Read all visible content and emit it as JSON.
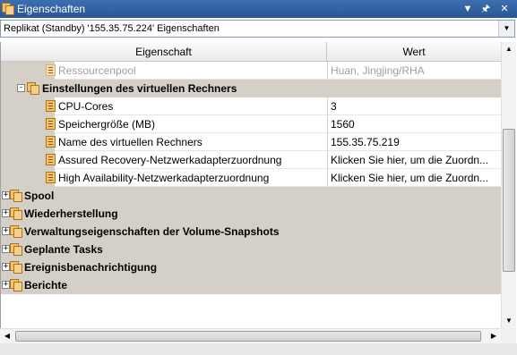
{
  "window": {
    "title": "Eigenschaften",
    "btn_dropdown": "▼",
    "btn_pin": "🖈",
    "btn_close": "✕"
  },
  "selector": {
    "value": "Replikat (Standby) '155.35.75.224' Eigenschaften"
  },
  "grid": {
    "headers": {
      "property": "Eigenschaft",
      "value": "Wert"
    },
    "rows": [
      {
        "name": "Ressourcenpool",
        "value": "Huan, Jingjing/RHA"
      },
      {
        "name": "Einstellungen des virtuellen Rechners"
      },
      {
        "name": "CPU-Cores",
        "value": "3"
      },
      {
        "name": "Speichergröße (MB)",
        "value": "1560"
      },
      {
        "name": "Name des virtuellen Rechners",
        "value": "155.35.75.219"
      },
      {
        "name": "Assured Recovery-Netzwerkadapterzuordnung",
        "value": "Klicken Sie hier, um die Zuordn..."
      },
      {
        "name": "High Availability-Netzwerkadapterzuordnung",
        "value": "Klicken Sie hier, um die Zuordn..."
      }
    ],
    "groups": [
      "Spool",
      "Wiederherstellung",
      "Verwaltungseigenschaften der Volume-Snapshots",
      "Geplante Tasks",
      "Ereignisbenachrichtigung",
      "Berichte"
    ]
  },
  "colors": {
    "titlebar": "#2a5592",
    "category_bg": "#d4d0c8",
    "disabled_text": "#a0a0a0"
  },
  "icons": [
    "properties-icon",
    "property-item-icon",
    "category-icon",
    "expand-icon",
    "collapse-icon"
  ]
}
